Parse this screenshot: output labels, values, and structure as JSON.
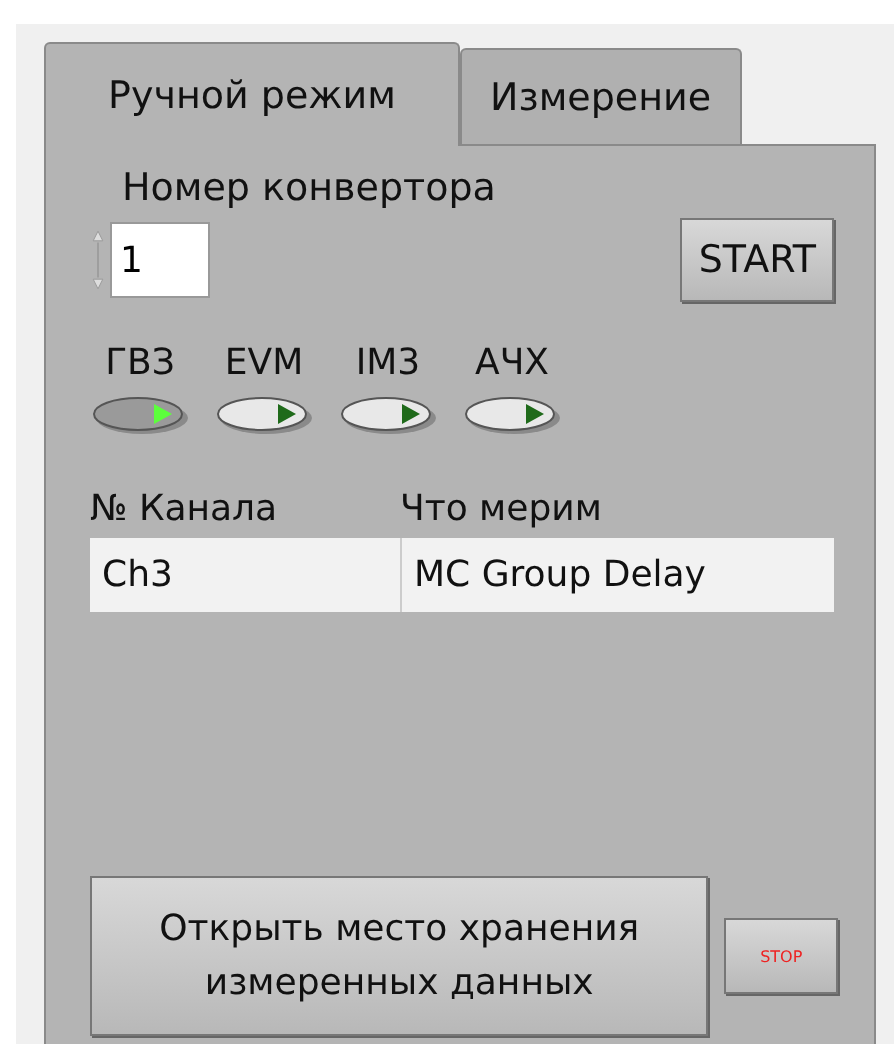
{
  "tabs": [
    {
      "label": "Ручной режим",
      "selected": true
    },
    {
      "label": "Измерение",
      "selected": false
    }
  ],
  "converter": {
    "label": "Номер конвертора",
    "value": "1"
  },
  "start_button": "START",
  "leds": [
    {
      "label": "ГВЗ",
      "on": true
    },
    {
      "label": "EVM",
      "on": false
    },
    {
      "label": "IM3",
      "on": false
    },
    {
      "label": "АЧХ",
      "on": false
    }
  ],
  "table": {
    "columns": [
      "№ Канала",
      "Что мерим"
    ],
    "rows": [
      [
        "Ch3",
        "MC Group Delay"
      ]
    ]
  },
  "open_button": "Открыть место хранения измеренных данных",
  "stop_button": "STOP"
}
